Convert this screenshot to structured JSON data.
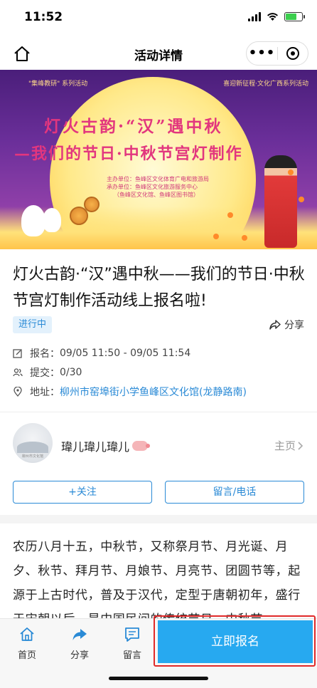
{
  "status_bar": {
    "time": "11:52"
  },
  "nav": {
    "title": "活动详情",
    "more_label": "•••"
  },
  "banner": {
    "top_left": "\"集峰教研\" 系列活动",
    "top_right": "喜迎新征程·文化广西系列活动",
    "line1": "灯火古韵·“汉”遇中秋",
    "line2": "—我们的节日·中秋节宫灯制作",
    "org_host": "主办单位：鱼峰区文化体育广电和旅游局",
    "org_undertake": "承办单位：鱼峰区文化旅游服务中心",
    "org_sub": "（鱼峰区文化馆、鱼峰区图书馆）"
  },
  "activity": {
    "title": "灯火古韵·“汉”遇中秋——我们的节日·中秋节宫灯制作活动线上报名啦!",
    "status": "进行中",
    "share_label": "分享",
    "signup_label": "报名：",
    "signup_value": "09/05 11:50 - 09/05 11:54",
    "submit_label": "提交：",
    "submit_value": "0/30",
    "address_label": "地址：",
    "address_value": "柳州市窑埠街小学鱼峰区文化馆(龙静路南)"
  },
  "organizer": {
    "avatar_caption": "柳州市文化馆",
    "name": "瑋儿瑋儿瑋儿",
    "homepage_label": "主页",
    "follow_label": "+关注",
    "message_label": "留言/电话"
  },
  "description": "农历八月十五，中秋节，又称祭月节、月光诞、月夕、秋节、拜月节、月娘节、月亮节、团圆节等，起源于上古时代，普及于汉代，定型于唐朝初年，盛行于宋朝以后，是中国民间的传统节日。中秋节",
  "bottom_bar": {
    "home_label": "首页",
    "share_label": "分享",
    "message_label": "留言",
    "signup_button": "立即报名"
  },
  "colors": {
    "accent": "#2a8ad6",
    "signup_button": "#27a9f0",
    "highlight": "#e02a2a",
    "status_tag_bg": "#e3f1fc"
  },
  "icons": [
    "home-icon",
    "more-icon",
    "target-icon",
    "share-icon",
    "edit-icon",
    "users-icon",
    "location-icon",
    "chevron-right-icon",
    "message-icon"
  ]
}
